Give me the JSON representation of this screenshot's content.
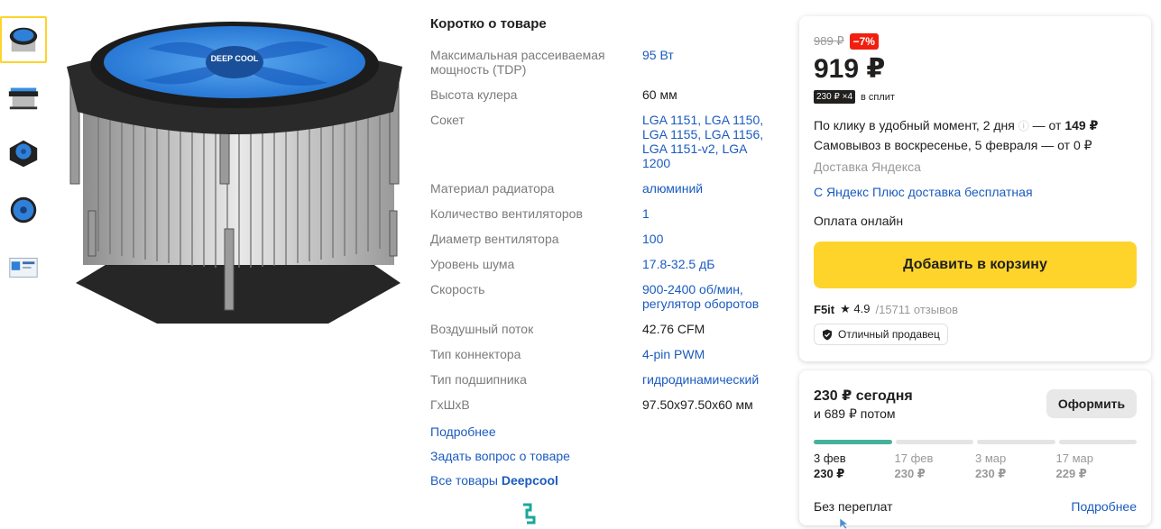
{
  "thumbnails": [
    {
      "icon": "cooler-top-view-icon",
      "active": true
    },
    {
      "icon": "cooler-side-view-icon",
      "active": false
    },
    {
      "icon": "cooler-angle-view-icon",
      "active": false
    },
    {
      "icon": "cooler-fan-view-icon",
      "active": false
    },
    {
      "icon": "cooler-box-icon",
      "active": false
    }
  ],
  "main_image": {
    "fan_label": "DEEP COOL"
  },
  "specs": {
    "title": "Коротко о товаре",
    "rows": [
      {
        "name": "Максимальная рассеиваемая мощность (TDP)",
        "value": "95 Вт",
        "link": true
      },
      {
        "name": "Высота кулера",
        "value": "60 мм",
        "link": false
      },
      {
        "name": "Сокет",
        "value": "LGA 1151, LGA 1150, LGA 1155, LGA 1156, LGA 1151-v2, LGA 1200",
        "link": true
      },
      {
        "name": "Материал радиатора",
        "value": "алюминий",
        "link": true
      },
      {
        "name": "Количество вентиляторов",
        "value": "1",
        "link": true
      },
      {
        "name": "Диаметр вентилятора",
        "value": "100",
        "link": true
      },
      {
        "name": "Уровень шума",
        "value": "17.8-32.5 дБ",
        "link": true
      },
      {
        "name": "Скорость",
        "value": "900-2400 об/мин, регулятор оборотов",
        "link": true
      },
      {
        "name": "Воздушный поток",
        "value": "42.76 CFM",
        "link": false
      },
      {
        "name": "Тип коннектора",
        "value": "4-pin PWM",
        "link": true
      },
      {
        "name": "Тип подшипника",
        "value": "гидродинамический",
        "link": true
      },
      {
        "name": "ГxШxВ",
        "value": "97.50x97.50x60 мм",
        "link": false
      }
    ],
    "more_link": "Подробнее",
    "ask_link": "Задать вопрос о товаре",
    "all_goods_prefix": "Все товары",
    "all_goods_brand": "Deepcool"
  },
  "offer": {
    "old_price": "989 ₽",
    "discount": "−7%",
    "price": "919 ₽",
    "split_badge": "230 ₽ ×4",
    "split_text": "в сплит",
    "delivery_1_pre": "По клику в удобный момент, 2 дня",
    "delivery_1_info": "ⓘ",
    "delivery_1_post": " — от ",
    "delivery_1_price": "149 ₽",
    "delivery_2": "Самовывоз в воскресенье, 5 февраля — от 0 ₽",
    "delivery_provider": "Доставка Яндекса",
    "plus_link": "С Яндекс Плюс доставка бесплатная",
    "payment": "Оплата онлайн",
    "cart_button": "Добавить в корзину",
    "seller_name": "F5it",
    "seller_rating": "★ 4.9",
    "seller_reviews_count": "15711",
    "seller_reviews_label": "отзывов",
    "seller_badge": "Отличный продавец"
  },
  "split": {
    "today": "230 ₽ сегодня",
    "later": "и 689 ₽ потом",
    "checkout_button": "Оформить",
    "schedule": [
      {
        "date": "3 фев",
        "amount": "230 ₽",
        "paid": true
      },
      {
        "date": "17 фев",
        "amount": "230 ₽",
        "paid": false
      },
      {
        "date": "3 мар",
        "amount": "230 ₽",
        "paid": false
      },
      {
        "date": "17 мар",
        "amount": "229 ₽",
        "paid": false
      }
    ],
    "no_overpay": "Без переплат",
    "more_link": "Подробнее"
  },
  "colors": {
    "accent_yellow": "#fed42b",
    "link_blue": "#1a5bbf",
    "discount_red": "#f11f0f",
    "split_green": "#45b19b"
  }
}
